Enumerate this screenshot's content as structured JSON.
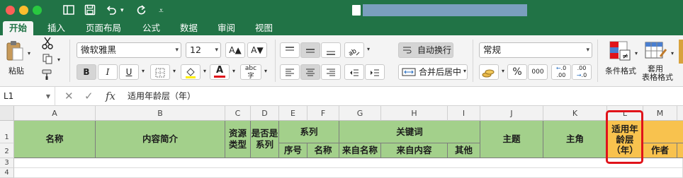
{
  "tabs": [
    "开始",
    "插入",
    "页面布局",
    "公式",
    "数据",
    "审阅",
    "视图"
  ],
  "ribbon": {
    "paste_label": "粘贴",
    "font_name": "微软雅黑",
    "font_size": "12",
    "grow_font": "A▲",
    "shrink_font": "A▼",
    "bold": "B",
    "italic": "I",
    "underline": "U",
    "font_color_letter": "A",
    "abc_label": "abc",
    "wrap_text": "自动换行",
    "merge_center": "合并后居中",
    "number_format": "常规",
    "percent": "%",
    "thousands": "000",
    "dec_inc": ".0",
    "dec_dec": ".00",
    "conditional_format": "条件格式",
    "table_style_line1": "套用",
    "table_style_line2": "表格格式"
  },
  "formula_bar": {
    "cell_ref": "L1",
    "fx": "fx",
    "content": "适用年龄层（年）"
  },
  "columns": [
    "A",
    "B",
    "C",
    "D",
    "E",
    "F",
    "G",
    "H",
    "I",
    "J",
    "K",
    "L",
    "M"
  ],
  "rows": [
    "1",
    "2",
    "3",
    "4"
  ],
  "headers": {
    "name": "名称",
    "intro": "内容简介",
    "resource_type": "资源\n类型",
    "is_series": "是否是\n系列",
    "series": "系列",
    "series_no": "序号",
    "series_name": "名称",
    "keywords": "关键词",
    "kw_from_name": "来自名称",
    "kw_from_content": "来自内容",
    "kw_other": "其他",
    "theme": "主题",
    "protagonist": "主角",
    "age_range": "适用年\n龄层\n（年）",
    "author": "作者"
  },
  "colors": {
    "excel_green": "#217346",
    "header_green": "#a3d08b",
    "header_orange": "#f8c24e",
    "highlight_red": "#e0131a"
  }
}
